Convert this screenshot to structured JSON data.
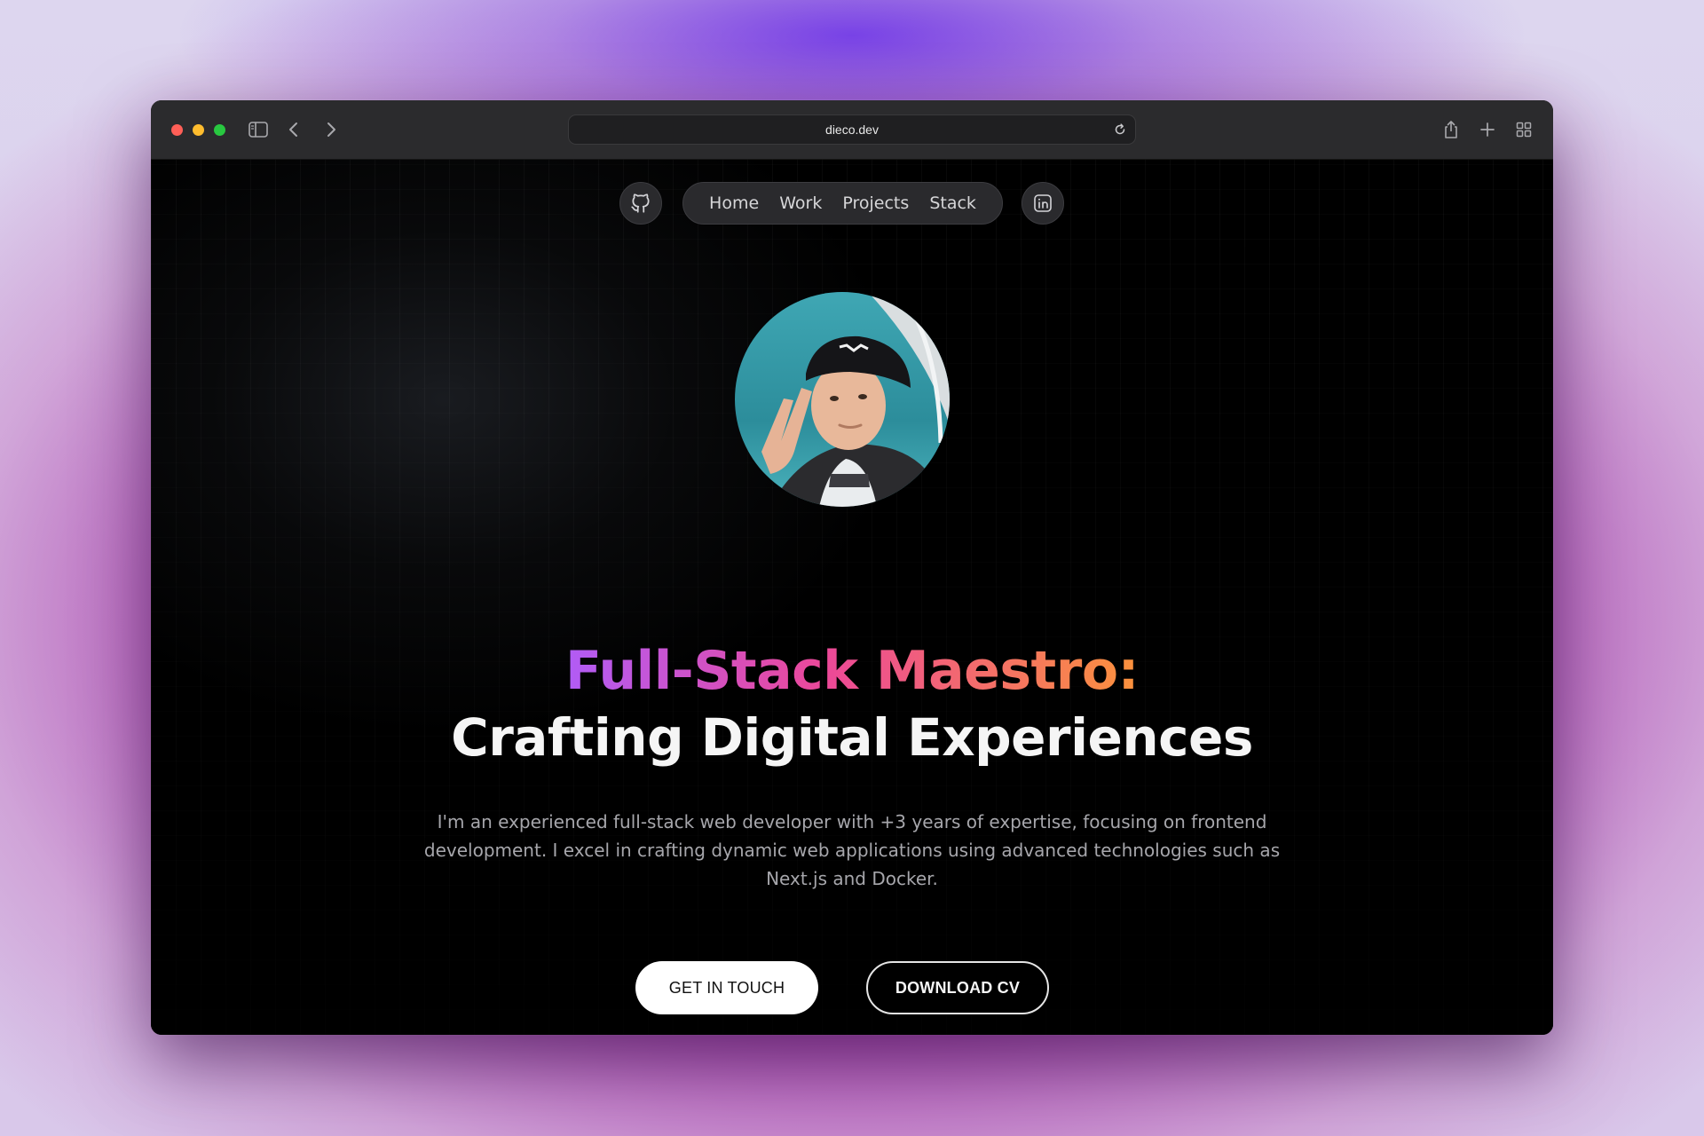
{
  "browser": {
    "url": "dieco.dev"
  },
  "nav": {
    "github_icon": "github-icon",
    "linkedin_icon": "linkedin-icon",
    "links": [
      "Home",
      "Work",
      "Projects",
      "Stack"
    ]
  },
  "hero": {
    "headline_accent": "Full-Stack Maestro:",
    "headline_main": "Crafting Digital Experiences",
    "bio": "I'm an experienced full-stack web developer with +3 years of expertise, focusing on frontend development. I excel in crafting dynamic web applications using advanced technologies such as Next.js and Docker.",
    "primary_cta": "GET IN TOUCH",
    "secondary_cta": "DOWNLOAD CV"
  },
  "colors": {
    "accent_gradient": [
      "#b15cf6",
      "#ec4899",
      "#fb923c"
    ],
    "background": "#000000",
    "close": "#ff5f57",
    "minimize": "#febc2e",
    "zoom": "#28c840"
  }
}
